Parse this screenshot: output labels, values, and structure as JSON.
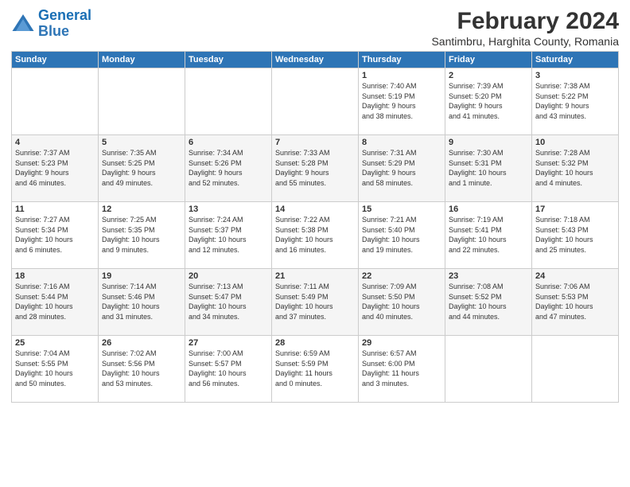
{
  "logo": {
    "line1": "General",
    "line2": "Blue"
  },
  "title": "February 2024",
  "subtitle": "Santimbru, Harghita County, Romania",
  "days_of_week": [
    "Sunday",
    "Monday",
    "Tuesday",
    "Wednesday",
    "Thursday",
    "Friday",
    "Saturday"
  ],
  "weeks": [
    [
      {
        "day": "",
        "info": ""
      },
      {
        "day": "",
        "info": ""
      },
      {
        "day": "",
        "info": ""
      },
      {
        "day": "",
        "info": ""
      },
      {
        "day": "1",
        "info": "Sunrise: 7:40 AM\nSunset: 5:19 PM\nDaylight: 9 hours\nand 38 minutes."
      },
      {
        "day": "2",
        "info": "Sunrise: 7:39 AM\nSunset: 5:20 PM\nDaylight: 9 hours\nand 41 minutes."
      },
      {
        "day": "3",
        "info": "Sunrise: 7:38 AM\nSunset: 5:22 PM\nDaylight: 9 hours\nand 43 minutes."
      }
    ],
    [
      {
        "day": "4",
        "info": "Sunrise: 7:37 AM\nSunset: 5:23 PM\nDaylight: 9 hours\nand 46 minutes."
      },
      {
        "day": "5",
        "info": "Sunrise: 7:35 AM\nSunset: 5:25 PM\nDaylight: 9 hours\nand 49 minutes."
      },
      {
        "day": "6",
        "info": "Sunrise: 7:34 AM\nSunset: 5:26 PM\nDaylight: 9 hours\nand 52 minutes."
      },
      {
        "day": "7",
        "info": "Sunrise: 7:33 AM\nSunset: 5:28 PM\nDaylight: 9 hours\nand 55 minutes."
      },
      {
        "day": "8",
        "info": "Sunrise: 7:31 AM\nSunset: 5:29 PM\nDaylight: 9 hours\nand 58 minutes."
      },
      {
        "day": "9",
        "info": "Sunrise: 7:30 AM\nSunset: 5:31 PM\nDaylight: 10 hours\nand 1 minute."
      },
      {
        "day": "10",
        "info": "Sunrise: 7:28 AM\nSunset: 5:32 PM\nDaylight: 10 hours\nand 4 minutes."
      }
    ],
    [
      {
        "day": "11",
        "info": "Sunrise: 7:27 AM\nSunset: 5:34 PM\nDaylight: 10 hours\nand 6 minutes."
      },
      {
        "day": "12",
        "info": "Sunrise: 7:25 AM\nSunset: 5:35 PM\nDaylight: 10 hours\nand 9 minutes."
      },
      {
        "day": "13",
        "info": "Sunrise: 7:24 AM\nSunset: 5:37 PM\nDaylight: 10 hours\nand 12 minutes."
      },
      {
        "day": "14",
        "info": "Sunrise: 7:22 AM\nSunset: 5:38 PM\nDaylight: 10 hours\nand 16 minutes."
      },
      {
        "day": "15",
        "info": "Sunrise: 7:21 AM\nSunset: 5:40 PM\nDaylight: 10 hours\nand 19 minutes."
      },
      {
        "day": "16",
        "info": "Sunrise: 7:19 AM\nSunset: 5:41 PM\nDaylight: 10 hours\nand 22 minutes."
      },
      {
        "day": "17",
        "info": "Sunrise: 7:18 AM\nSunset: 5:43 PM\nDaylight: 10 hours\nand 25 minutes."
      }
    ],
    [
      {
        "day": "18",
        "info": "Sunrise: 7:16 AM\nSunset: 5:44 PM\nDaylight: 10 hours\nand 28 minutes."
      },
      {
        "day": "19",
        "info": "Sunrise: 7:14 AM\nSunset: 5:46 PM\nDaylight: 10 hours\nand 31 minutes."
      },
      {
        "day": "20",
        "info": "Sunrise: 7:13 AM\nSunset: 5:47 PM\nDaylight: 10 hours\nand 34 minutes."
      },
      {
        "day": "21",
        "info": "Sunrise: 7:11 AM\nSunset: 5:49 PM\nDaylight: 10 hours\nand 37 minutes."
      },
      {
        "day": "22",
        "info": "Sunrise: 7:09 AM\nSunset: 5:50 PM\nDaylight: 10 hours\nand 40 minutes."
      },
      {
        "day": "23",
        "info": "Sunrise: 7:08 AM\nSunset: 5:52 PM\nDaylight: 10 hours\nand 44 minutes."
      },
      {
        "day": "24",
        "info": "Sunrise: 7:06 AM\nSunset: 5:53 PM\nDaylight: 10 hours\nand 47 minutes."
      }
    ],
    [
      {
        "day": "25",
        "info": "Sunrise: 7:04 AM\nSunset: 5:55 PM\nDaylight: 10 hours\nand 50 minutes."
      },
      {
        "day": "26",
        "info": "Sunrise: 7:02 AM\nSunset: 5:56 PM\nDaylight: 10 hours\nand 53 minutes."
      },
      {
        "day": "27",
        "info": "Sunrise: 7:00 AM\nSunset: 5:57 PM\nDaylight: 10 hours\nand 56 minutes."
      },
      {
        "day": "28",
        "info": "Sunrise: 6:59 AM\nSunset: 5:59 PM\nDaylight: 11 hours\nand 0 minutes."
      },
      {
        "day": "29",
        "info": "Sunrise: 6:57 AM\nSunset: 6:00 PM\nDaylight: 11 hours\nand 3 minutes."
      },
      {
        "day": "",
        "info": ""
      },
      {
        "day": "",
        "info": ""
      }
    ]
  ]
}
